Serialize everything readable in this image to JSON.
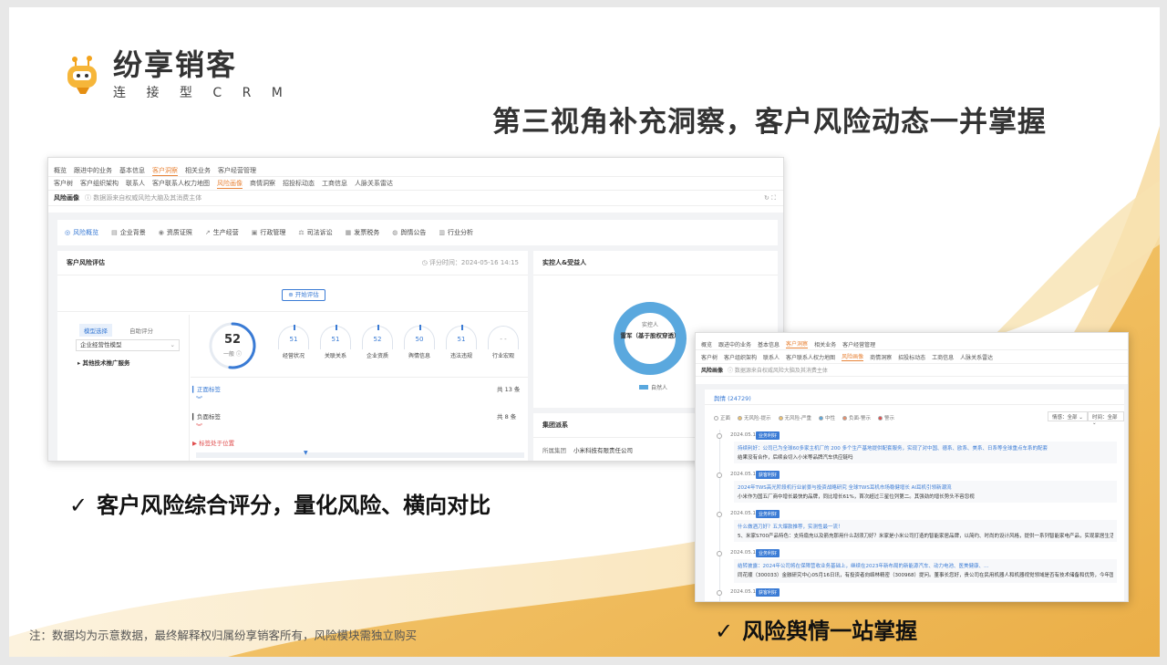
{
  "brand": {
    "name": "纷享销客",
    "tagline": "连 接 型 C R M"
  },
  "headline": "第三视角补充洞察，客户风险动态一并掌握",
  "features": [
    {
      "check": "✓",
      "text": "客户风险综合评分，量化风险、横向对比"
    },
    {
      "check": "✓",
      "text": "风险舆情一站掌握"
    }
  ],
  "footnote": "注：数据均为示意数据，最终解释权归属纷享销客所有，风险模块需独立购买",
  "shot1": {
    "nav_primary": [
      "概览",
      "跟进中的业务",
      "基本信息",
      "客户洞察",
      "相关业务",
      "客户经营管理"
    ],
    "nav_primary_active": "客户洞察",
    "nav_secondary": [
      "客户树",
      "客户组织架构",
      "联系人",
      "客户联系人权力地图",
      "风险画像",
      "商情洞察",
      "招投标动态",
      "工商信息",
      "人脉关系雷达"
    ],
    "nav_secondary_active": "风险画像",
    "risk_title": "风险画像",
    "risk_note": "ⓘ 数据源来自权威风险大脑及其消费主体",
    "tools": "↻  ⛶",
    "tabs": [
      {
        "icon": "◎",
        "label": "风险概览",
        "active": true
      },
      {
        "icon": "▤",
        "label": "企业背景"
      },
      {
        "icon": "◉",
        "label": "资质证照"
      },
      {
        "icon": "↗",
        "label": "生产经营"
      },
      {
        "icon": "▣",
        "label": "行政管理"
      },
      {
        "icon": "⚖",
        "label": "司法诉讼"
      },
      {
        "icon": "▦",
        "label": "发票税务"
      },
      {
        "icon": "◍",
        "label": "舆情公告"
      },
      {
        "icon": "▥",
        "label": "行业分析"
      }
    ],
    "eval": {
      "title": "客户风险评估",
      "time": "◷ 评分时间：2024-05-16 14:15",
      "start_btn": "⊕ 开始评估",
      "model_tabs": [
        "模型选择",
        "自助评分"
      ],
      "model_selected": "企业经营性模型",
      "model_link": "▸ 其他技术推广服务",
      "score": "52",
      "score_level": "一般 ⓘ",
      "score_fill": 0.52,
      "dims": [
        {
          "label": "经营状况",
          "value": "51"
        },
        {
          "label": "关联关系",
          "value": "51"
        },
        {
          "label": "企业资质",
          "value": "52"
        },
        {
          "label": "舆情信息",
          "value": "50"
        },
        {
          "label": "违法违规",
          "value": "51"
        },
        {
          "label": "行业宏观",
          "value": "- -"
        }
      ],
      "pos_tag": "▎正面标签",
      "pos_count": "共 13 条",
      "neg_tag": "▎负面标签",
      "neg_count": "共 8 条",
      "position": "▶ 标签处于位置"
    },
    "controller": {
      "title": "实控人&受益人",
      "center_label": "实控人",
      "center_name": "雷军（基于股权穿透）",
      "legend": "自然人"
    },
    "group": {
      "title": "集团派系",
      "row_label": "所属集团",
      "row_value": "小米科技有限责任公司"
    }
  },
  "shot2": {
    "nav_primary": [
      "概览",
      "跟进中的业务",
      "基本信息",
      "客户洞察",
      "相关业务",
      "客户经营管理"
    ],
    "nav_primary_active": "客户洞察",
    "nav_secondary": [
      "客户树",
      "客户组织架构",
      "联系人",
      "客户联系人权力地图",
      "风险画像",
      "商情洞察",
      "招投标动态",
      "工商信息",
      "人脉关系雷达"
    ],
    "nav_secondary_active": "风险画像",
    "risk_title": "风险画像",
    "risk_note": "ⓘ 数据源来自权威风险大脑及其消费主体",
    "tab": "舆情 (24729)",
    "legend": [
      {
        "label": "正面",
        "color": "#ffffff"
      },
      {
        "label": "无风险-提示",
        "color": "#f2c46d"
      },
      {
        "label": "无风险-严重",
        "color": "#f2c46d"
      },
      {
        "label": "中性",
        "color": "#5aa8de"
      },
      {
        "label": "负面-警示",
        "color": "#e88f6a"
      },
      {
        "label": "警示",
        "color": "#e04d4d"
      }
    ],
    "filter_sentiment": "情感：全部 ⌄",
    "filter_time": "时间：全部 ⌄",
    "events": [
      {
        "date": "2024.05.16",
        "badge": "业务利好",
        "title": "持续利好：公司已为全球60多家主机厂的 200 多个生产基地提供配套服务，实现了对中国、德系、欧系、美系、日系等全球重点车系的配套",
        "desc": "结果没有合作，后续会切入小米等品牌汽车供应链吗"
      },
      {
        "date": "2024.05.16",
        "badge": "获客利好",
        "title": "2024年TWS高光阶段机行业前景与投资战略研究 全球TWS耳机市场稳健增长 AI耳机引领新潮流",
        "desc": "小米作为国五厂商中增长最快的品牌，同比增长61%，首次超过三星位列第二。其强劲的增长势头不容忽视"
      },
      {
        "date": "2024.05.16",
        "badge": "业务利好",
        "title": "什么做酒刀好？五大爆款推荐，实测性最一流！",
        "desc": "5、米家S700产品特色：支持扇充以及箭充那用什么刮须刀好？米家是小米公司打造的智能家居品牌，以简约、时尚的设计风格，提供一系列智能家电产品，实现家居生活的智能化"
      },
      {
        "date": "2024.05.16",
        "badge": "业务利好",
        "title": "结转披露：2024年公司将在保障营收业务基础上，继续在2023年新布局的新能源汽车、动力电池、医美健康、…",
        "desc": "同花顺（300033）金融研究中心05月16日讯，有投资者向络林精密（300968）提问。董事长您好，贵公司在民用机器人和机器视觉领域是否有技术储备和优势，今年国家倡导设备更新家用消费电子占领大批量，贵公司是为富士康、小米、华为的合作伙伴是否有应对方案和举措"
      },
      {
        "date": "2024.05.16",
        "badge": "获客利好",
        "title": "",
        "desc": ""
      }
    ]
  }
}
